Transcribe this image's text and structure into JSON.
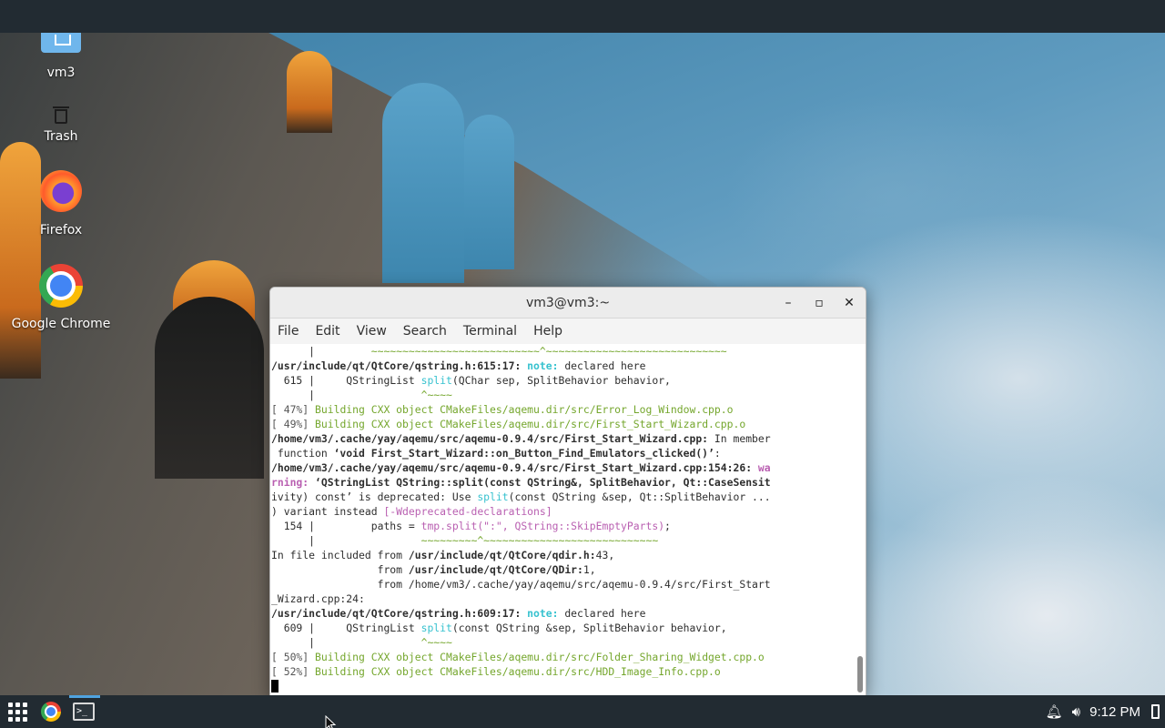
{
  "desktop": {
    "icons": [
      {
        "label": "vm3",
        "icon": "home-folder-icon"
      },
      {
        "label": "Trash",
        "icon": "trash-icon"
      },
      {
        "label": "Firefox",
        "icon": "firefox-icon"
      },
      {
        "label": "Google Chrome",
        "icon": "chrome-icon"
      }
    ]
  },
  "terminal": {
    "title": "vm3@vm3:~",
    "buttons": {
      "minimize": "–",
      "maximize": "▫",
      "close": "✕"
    },
    "menu": [
      "File",
      "Edit",
      "View",
      "Search",
      "Terminal",
      "Help"
    ],
    "lines": [
      "      |         ~~~~~~~~~~~~~~~~~~~~~~~~~~~^~~~~~~~~~~~~~~~~~~~~~~~~~~~~~",
      "/usr/include/qt/QtCore/qstring.h:615:17: note: declared here",
      "  615 |     QStringList split(QChar sep, SplitBehavior behavior,",
      "      |                 ^~~~~",
      "[ 47%] Building CXX object CMakeFiles/aqemu.dir/src/Error_Log_Window.cpp.o",
      "[ 49%] Building CXX object CMakeFiles/aqemu.dir/src/First_Start_Wizard.cpp.o",
      "/home/vm3/.cache/yay/aqemu/src/aqemu-0.9.4/src/First_Start_Wizard.cpp: In member",
      " function ‘void First_Start_Wizard::on_Button_Find_Emulators_clicked()’:",
      "/home/vm3/.cache/yay/aqemu/src/aqemu-0.9.4/src/First_Start_Wizard.cpp:154:26: wa",
      "rning: ‘QStringList QString::split(const QString&, SplitBehavior, Qt::CaseSensit",
      "ivity) const’ is deprecated: Use split(const QString &sep, Qt::SplitBehavior ...",
      ") variant instead [-Wdeprecated-declarations]",
      "  154 |         paths = tmp.split(\":\", QString::SkipEmptyParts);",
      "      |                 ~~~~~~~~~^~~~~~~~~~~~~~~~~~~~~~~~~~~~~",
      "In file included from /usr/include/qt/QtCore/qdir.h:43,",
      "                 from /usr/include/qt/QtCore/QDir:1,",
      "                 from /home/vm3/.cache/yay/aqemu/src/aqemu-0.9.4/src/First_Start",
      "_Wizard.cpp:24:",
      "/usr/include/qt/QtCore/qstring.h:609:17: note: declared here",
      "  609 |     QStringList split(const QString &sep, SplitBehavior behavior,",
      "      |                 ^~~~~",
      "[ 50%] Building CXX object CMakeFiles/aqemu.dir/src/Folder_Sharing_Widget.cpp.o",
      "[ 52%] Building CXX object CMakeFiles/aqemu.dir/src/HDD_Image_Info.cpp.o"
    ]
  },
  "taskbar": {
    "apps_icon": "app-grid-icon",
    "pinned": [
      "chrome-icon",
      "terminal-icon"
    ],
    "tray": {
      "notification_icon": "bell-icon",
      "volume_icon": "speaker-icon",
      "clock": "9:12 PM",
      "power_icon": "power-icon"
    }
  },
  "colors": {
    "panel": "#222b32",
    "terminal_green": "#74a62c",
    "terminal_cyan": "#37c2cf",
    "terminal_magenta": "#b95fb1"
  }
}
